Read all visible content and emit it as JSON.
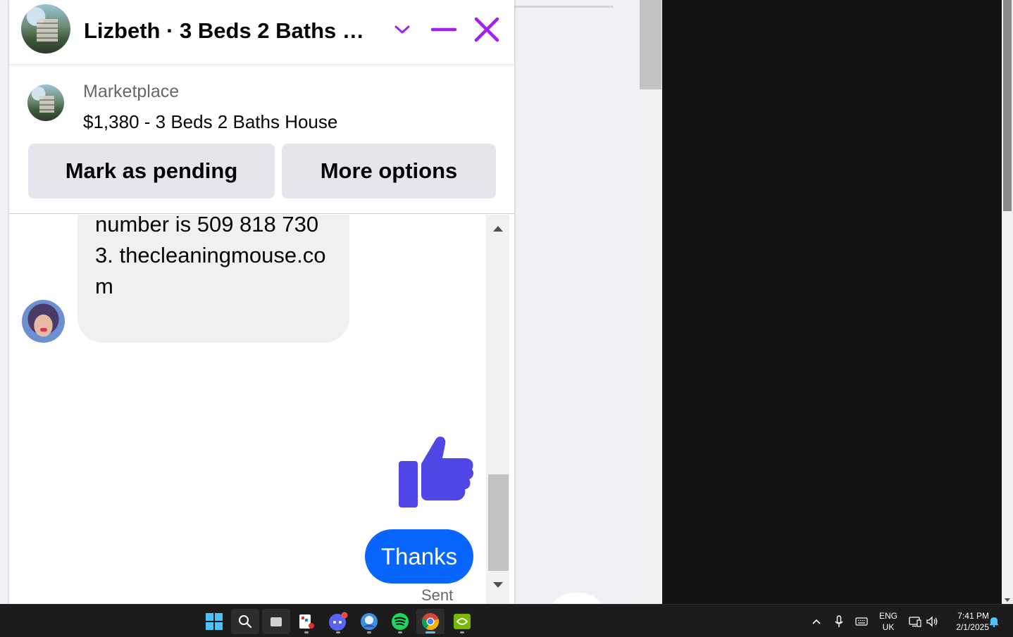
{
  "chat": {
    "title": "Lizbeth · 3 Beds 2 Baths House",
    "listing": {
      "source": "Marketplace",
      "title": "$1,380 - 3 Beds 2 Baths House"
    },
    "buttons": {
      "pending": "Mark as pending",
      "more": "More options"
    },
    "messages": {
      "received_text": "number is 509 818 7303. thecleaningmouse.com",
      "sent_text": "Thanks",
      "status": "Sent"
    },
    "colors": {
      "accent": "#a020f0",
      "bubble_blue": "#0866ff",
      "like_blue": "#4f46e5"
    }
  },
  "taskbar": {
    "icons": [
      "windows-start-icon",
      "search-icon",
      "task-view-icon",
      "snipping-tool-icon",
      "discord-icon",
      "app-icon",
      "spotify-icon",
      "chrome-icon",
      "nvidia-icon"
    ],
    "language": {
      "code": "ENG",
      "region": "UK"
    },
    "clock": {
      "time": "7:41 PM",
      "date": "2/1/2025"
    }
  }
}
